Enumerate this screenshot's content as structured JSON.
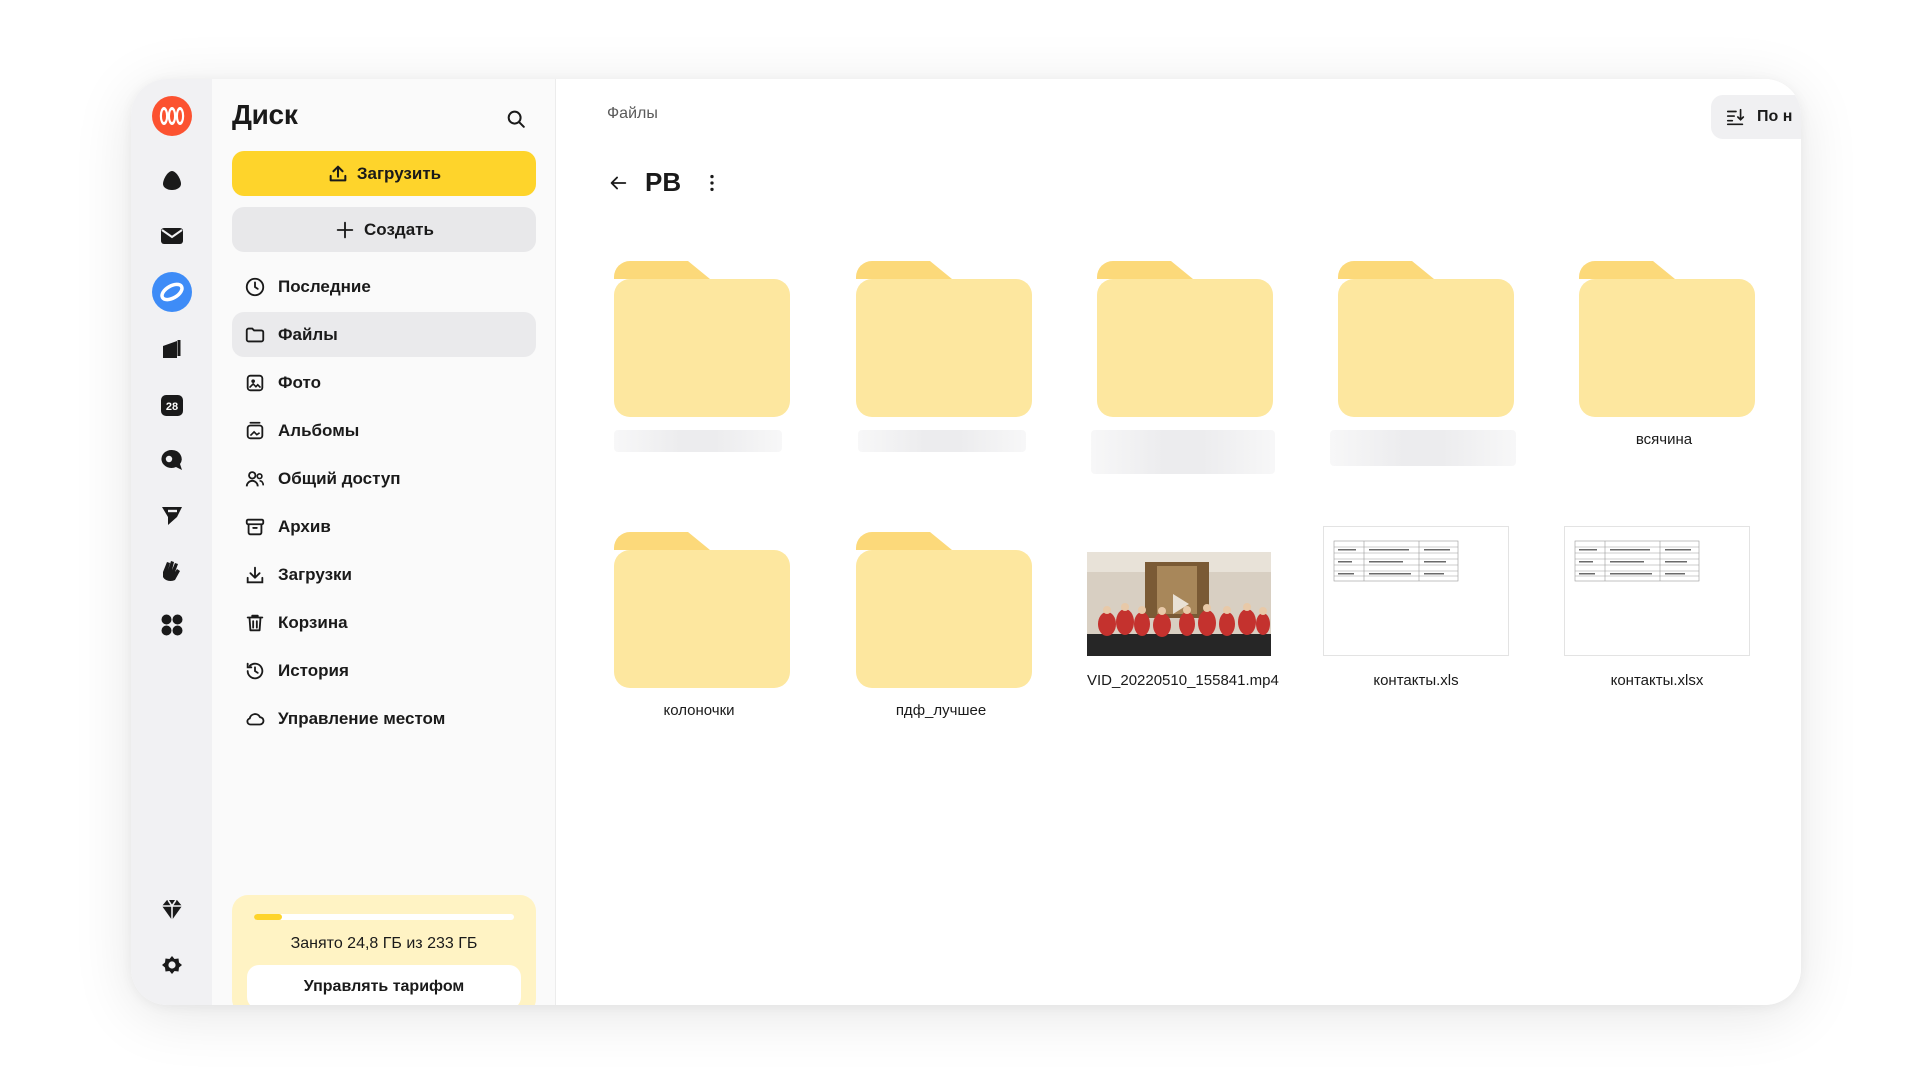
{
  "sidebar": {
    "title": "Диск",
    "upload_label": "Загрузить",
    "create_label": "Создать",
    "nav": [
      {
        "label": "Последние",
        "icon": "clock-icon"
      },
      {
        "label": "Файлы",
        "icon": "folder-icon"
      },
      {
        "label": "Фото",
        "icon": "photo-icon"
      },
      {
        "label": "Альбомы",
        "icon": "album-icon"
      },
      {
        "label": "Общий доступ",
        "icon": "shared-icon"
      },
      {
        "label": "Архив",
        "icon": "archive-icon"
      },
      {
        "label": "Загрузки",
        "icon": "download-icon"
      },
      {
        "label": "Корзина",
        "icon": "trash-icon"
      },
      {
        "label": "История",
        "icon": "history-icon"
      },
      {
        "label": "Управление местом",
        "icon": "cloud-icon"
      }
    ],
    "active_item": "Файлы",
    "storage": {
      "text": "Занято 24,8 ГБ из 233 ГБ",
      "used_fraction": 0.106,
      "tariff_label": "Управлять тарифом"
    }
  },
  "rail": {
    "calendar_day": "28",
    "icons": [
      "app-logo-icon",
      "cloud-drop-icon",
      "mail-icon",
      "disk-icon",
      "docs-icon",
      "calendar-icon",
      "messenger-icon",
      "telemost-icon",
      "notes-icon",
      "services-icon",
      "premium-icon",
      "settings-icon"
    ]
  },
  "main": {
    "breadcrumb": "Файлы",
    "sort_label": "По н",
    "folder_name": "РВ",
    "items": [
      {
        "kind": "folder",
        "name": ""
      },
      {
        "kind": "folder",
        "name": ""
      },
      {
        "kind": "folder",
        "name": ""
      },
      {
        "kind": "folder",
        "name": ""
      },
      {
        "kind": "folder",
        "name": "всячина"
      },
      {
        "kind": "folder",
        "name": "колоночки"
      },
      {
        "kind": "folder",
        "name": "пдф_лучшее"
      },
      {
        "kind": "video",
        "name": "VID_20220510_155841.mp4"
      },
      {
        "kind": "spreadsheet",
        "name": "контакты.xls"
      },
      {
        "kind": "spreadsheet",
        "name": "контакты.xlsx"
      }
    ]
  },
  "colors": {
    "accent_yellow": "#fed42b",
    "folder_yellow": "#fde79f",
    "disk_blue": "#3e8cf7",
    "logo_orange": "#fc5230"
  }
}
